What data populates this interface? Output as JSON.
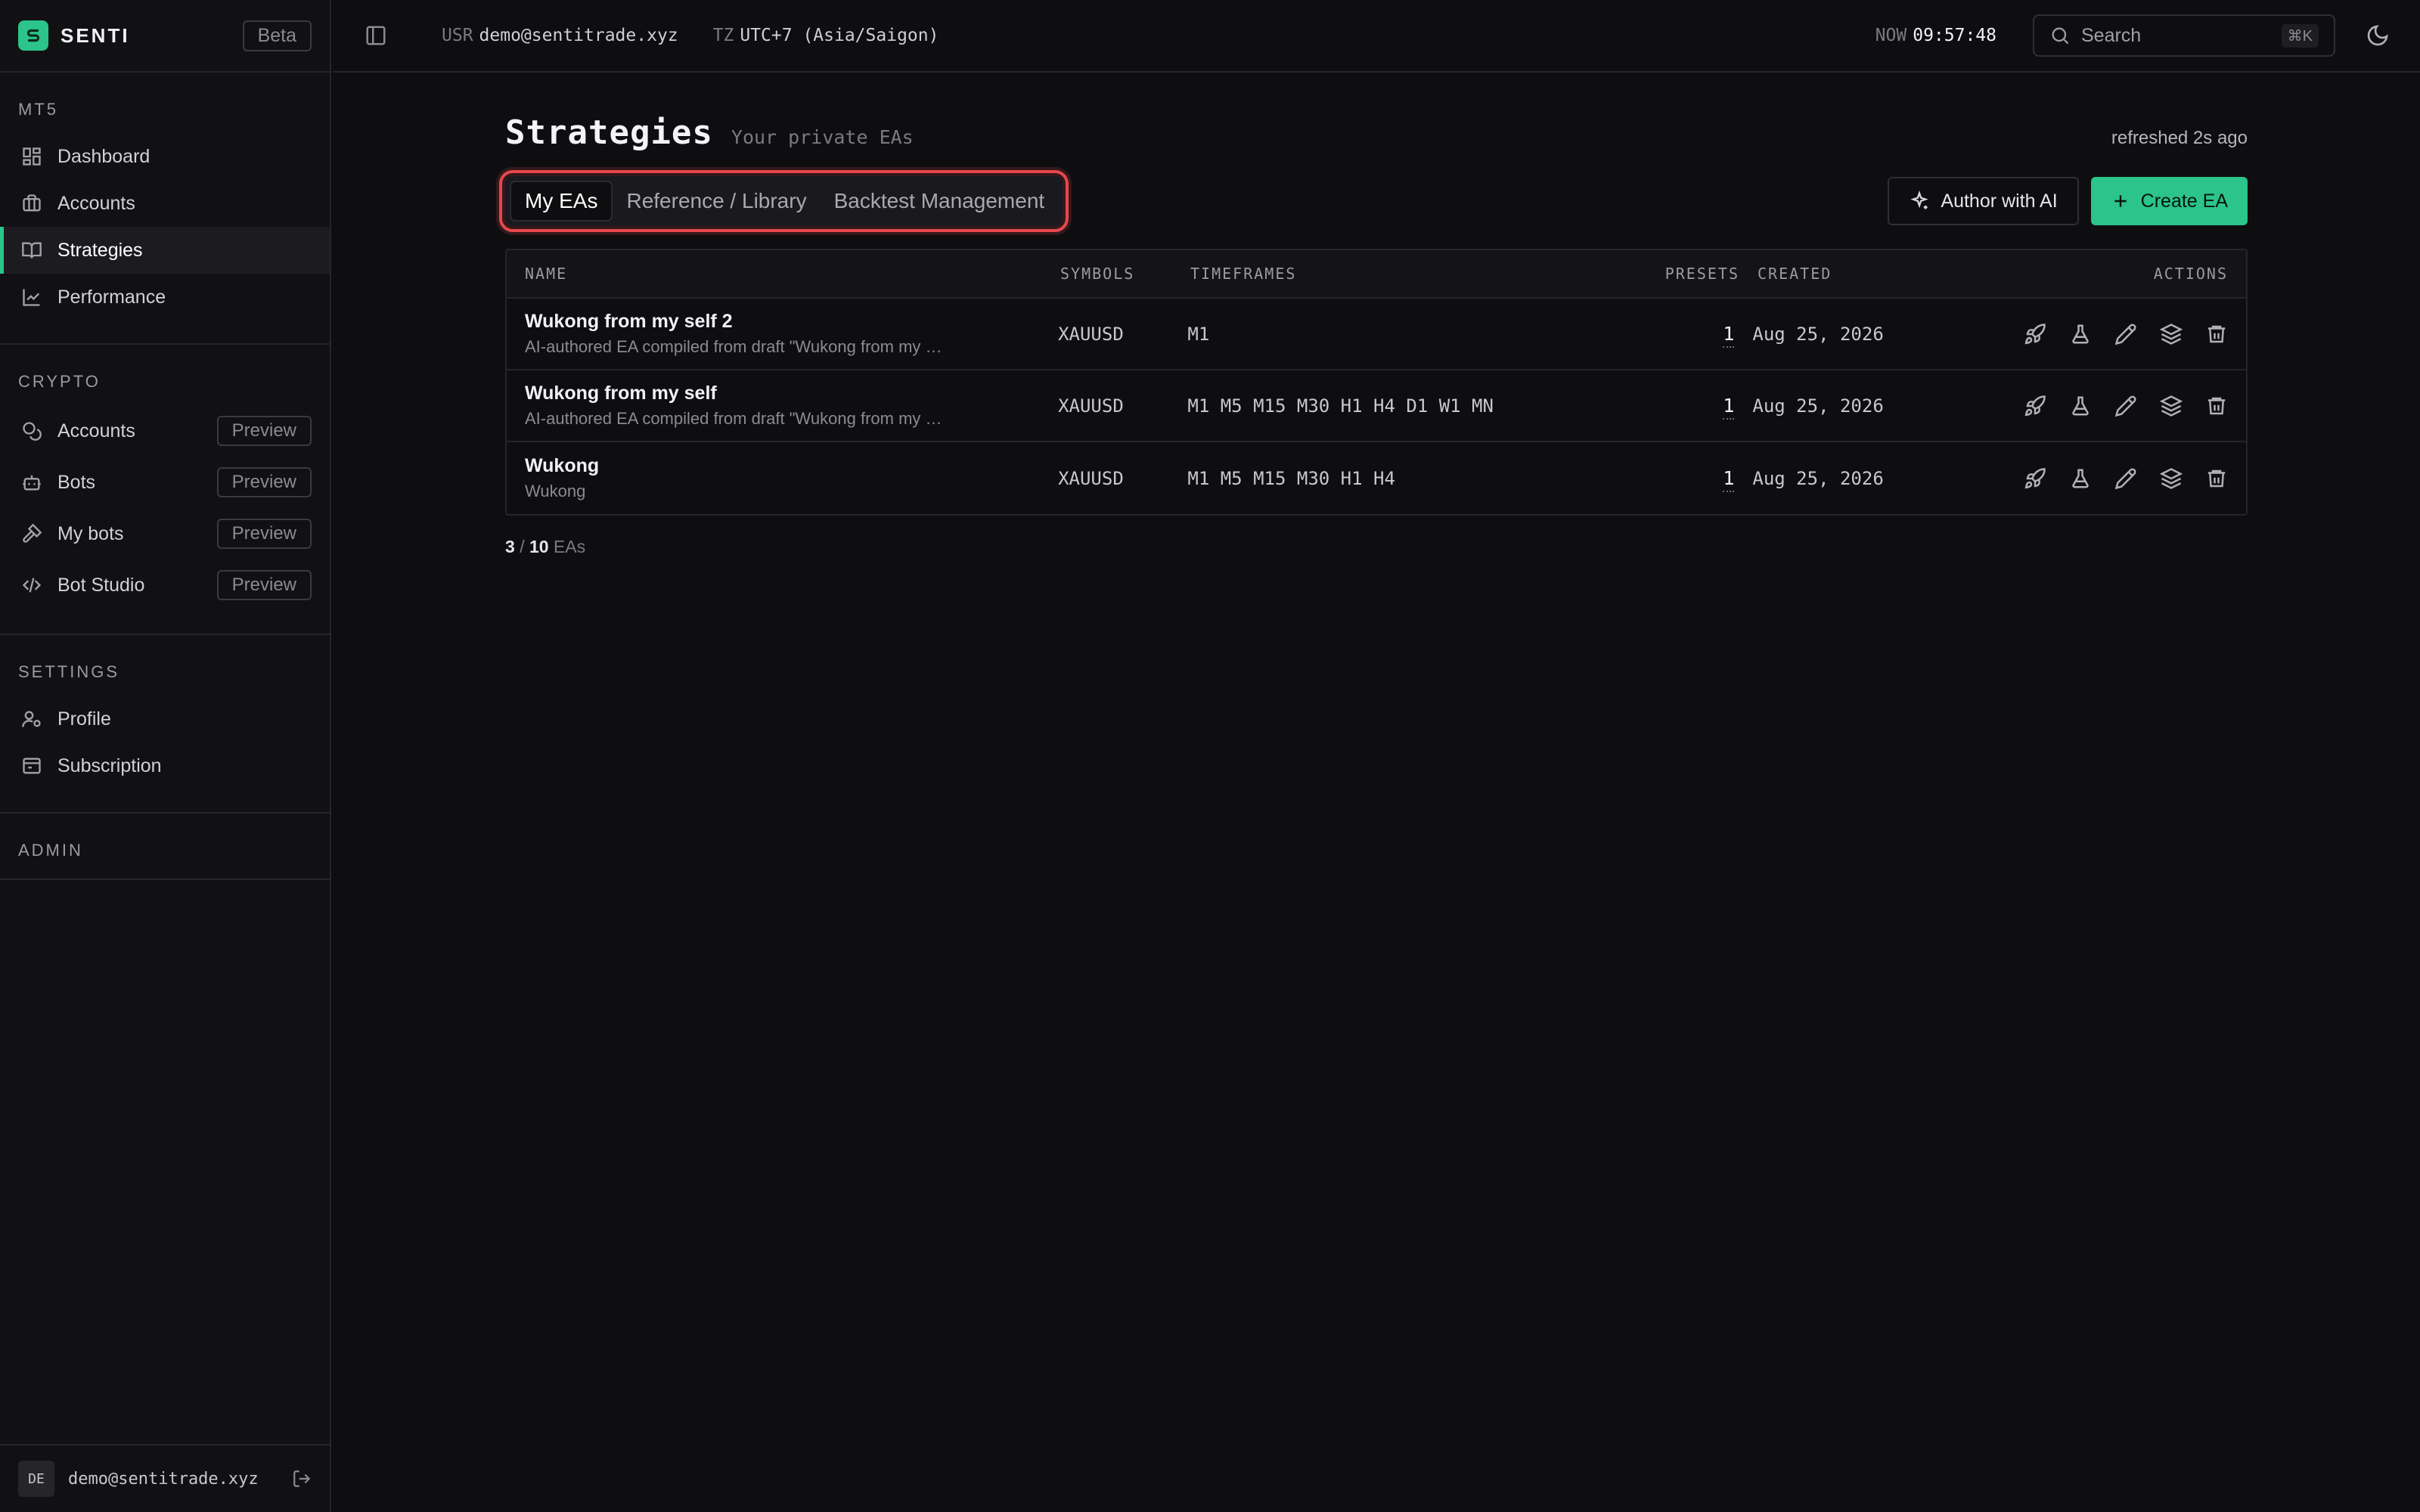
{
  "brand": {
    "name": "SENTI",
    "badge": "Beta"
  },
  "sidebar": {
    "sections": [
      {
        "title": "MT5",
        "items": [
          {
            "label": "Dashboard",
            "icon": "dashboard-icon"
          },
          {
            "label": "Accounts",
            "icon": "briefcase-icon"
          },
          {
            "label": "Strategies",
            "icon": "book-icon",
            "active": true
          },
          {
            "label": "Performance",
            "icon": "chart-line-icon"
          }
        ]
      },
      {
        "title": "CRYPTO",
        "items": [
          {
            "label": "Accounts",
            "icon": "coins-icon",
            "badge": "Preview"
          },
          {
            "label": "Bots",
            "icon": "bot-icon",
            "badge": "Preview"
          },
          {
            "label": "My bots",
            "icon": "hammer-icon",
            "badge": "Preview"
          },
          {
            "label": "Bot Studio",
            "icon": "code-icon",
            "badge": "Preview"
          }
        ]
      },
      {
        "title": "SETTINGS",
        "items": [
          {
            "label": "Profile",
            "icon": "user-cog-icon"
          },
          {
            "label": "Subscription",
            "icon": "card-icon"
          }
        ]
      },
      {
        "title": "ADMIN",
        "items": []
      }
    ],
    "footer": {
      "avatar": "DE",
      "email": "demo@sentitrade.xyz"
    }
  },
  "topbar": {
    "user_key": "USR",
    "user_value": "demo@sentitrade.xyz",
    "tz_key": "TZ",
    "tz_value": "UTC+7 (Asia/Saigon)",
    "now_key": "NOW",
    "now_value": "09:57:48",
    "search_placeholder": "Search",
    "search_shortcut": "⌘K"
  },
  "page": {
    "title": "Strategies",
    "subtitle": "Your private EAs",
    "refreshed": "refreshed 2s ago",
    "tabs": [
      {
        "label": "My EAs",
        "active": true
      },
      {
        "label": "Reference / Library"
      },
      {
        "label": "Backtest Management"
      }
    ],
    "author_ai_label": "Author with AI",
    "create_label": "Create EA"
  },
  "table": {
    "headers": {
      "name": "NAME",
      "symbols": "SYMBOLS",
      "timeframes": "TIMEFRAMES",
      "presets": "PRESETS",
      "created": "CREATED",
      "actions": "ACTIONS"
    },
    "rows": [
      {
        "name": "Wukong from my self 2",
        "desc": "AI-authored EA compiled from draft \"Wukong from my …",
        "symbols": "XAUUSD",
        "timeframes": "M1",
        "presets": "1",
        "created": "Aug 25, 2026"
      },
      {
        "name": "Wukong from my self",
        "desc": "AI-authored EA compiled from draft \"Wukong from my …",
        "symbols": "XAUUSD",
        "timeframes": "M1 M5 M15 M30 H1 H4 D1 W1 MN",
        "presets": "1",
        "created": "Aug 25, 2026"
      },
      {
        "name": "Wukong",
        "desc": "Wukong",
        "symbols": "XAUUSD",
        "timeframes": "M1 M5 M15 M30 H1 H4",
        "presets": "1",
        "created": "Aug 25, 2026"
      }
    ],
    "count_shown": "3",
    "count_sep": "/",
    "count_total": "10",
    "count_unit": "EAs"
  },
  "colors": {
    "accent": "#2bc48a",
    "highlight": "#e5484d",
    "background": "#0e0e10"
  }
}
